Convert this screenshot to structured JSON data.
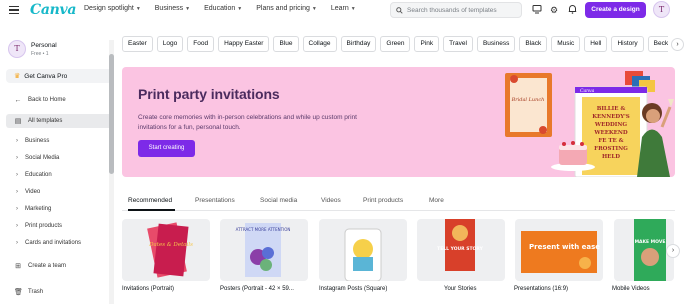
{
  "topbar": {
    "logo": "Canva",
    "nav": [
      "Design spotlight",
      "Business",
      "Education",
      "Plans and pricing",
      "Learn"
    ],
    "search_placeholder": "Search thousands of templates",
    "create_label": "Create a design",
    "avatar_initial": "T"
  },
  "sidebar": {
    "team_name": "Personal",
    "team_sub": "Free • 1",
    "avatar_initial": "T",
    "pro_label": "Get Canva Pro",
    "back_label": "Back to Home",
    "all_templates_label": "All templates",
    "sub_items": [
      "Business",
      "Social Media",
      "Education",
      "Video",
      "Marketing",
      "Print products",
      "Cards and invitations"
    ],
    "create_team_label": "Create a team",
    "trash_label": "Trash"
  },
  "chips": [
    "Easter",
    "Logo",
    "Food",
    "Happy Easter",
    "Blue",
    "Collage",
    "Birthday",
    "Green",
    "Pink",
    "Travel",
    "Business",
    "Black",
    "Music",
    "Hell",
    "History",
    "Beck"
  ],
  "banner": {
    "title": "Print party invitations",
    "desc": "Create core memories with in-person celebrations and while up custom print invitations for a fun, personal touch.",
    "button": "Start creating",
    "mock_canva_label": "Canva",
    "invite_lines": [
      "BILLIE &",
      "KENNEDY'S",
      "WEDDING",
      "WEEKEND",
      "FE TE &",
      "FROSTING",
      "HELD"
    ],
    "card_script": "Bridal Lunch"
  },
  "tabs": [
    "Recommended",
    "Presentations",
    "Social media",
    "Videos",
    "Print products",
    "More"
  ],
  "cards": [
    {
      "label": "Invitations (Portrait)",
      "text": "Dates & Details"
    },
    {
      "label": "Posters (Portrait - 42 × 59...",
      "text": "ATTRACT MORE ATTENTION"
    },
    {
      "label": "Instagram Posts (Square)",
      "text": ""
    },
    {
      "label": "Your Stories",
      "text": "TELL YOUR STORY"
    },
    {
      "label": "Presentations (16:9)",
      "text": "Present with ease"
    },
    {
      "label": "Mobile Videos",
      "text": "MAKE MOVE"
    }
  ],
  "colors": {
    "brand_purple": "#7d2ae8",
    "banner_pink": "#fbc4e2",
    "logo_teal": "#17b8c9"
  }
}
